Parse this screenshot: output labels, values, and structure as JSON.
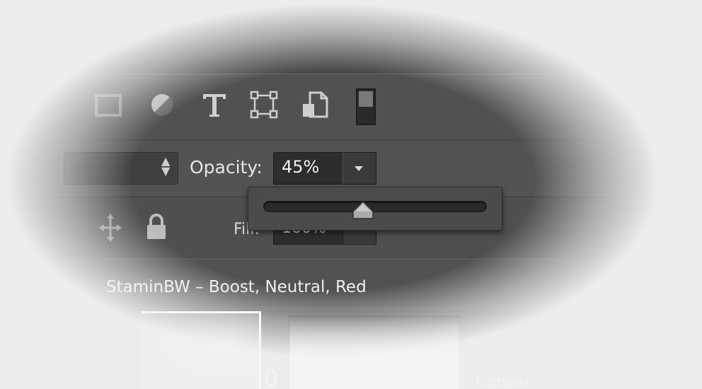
{
  "layers_panel": {
    "filter_icons": [
      {
        "name": "pixel-layer-filter-icon"
      },
      {
        "name": "adjustment-layer-filter-icon"
      },
      {
        "name": "type-layer-filter-icon"
      },
      {
        "name": "shape-layer-filter-icon"
      },
      {
        "name": "smart-object-filter-icon"
      },
      {
        "name": "filter-toggle-icon"
      }
    ],
    "opacity": {
      "label": "Opacity:",
      "value": "45%",
      "slider_fraction": 0.45
    },
    "fill": {
      "label": "Fill:",
      "value": "100%"
    },
    "layer_name": "StaminBW – Boost, Neutral, Red",
    "thumbnail_caption": "Conver"
  },
  "colors": {
    "panel_bg": "#535353",
    "field_bg": "#2d2d2d",
    "text": "#e6e6e6"
  }
}
